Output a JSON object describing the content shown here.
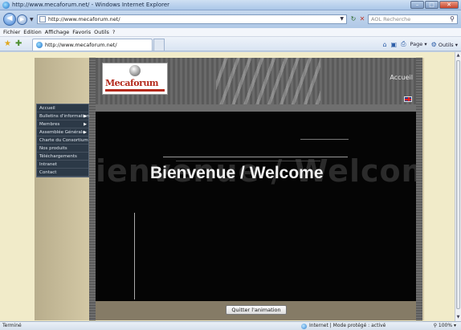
{
  "window": {
    "title": "http://www.mecaforum.net/ - Windows Internet Explorer"
  },
  "addressbar": {
    "url": "http://www.mecaforum.net/",
    "search_placeholder": "AOL Recherche"
  },
  "menubar": {
    "items": [
      "Fichier",
      "Edition",
      "Affichage",
      "Favoris",
      "Outils",
      "?"
    ]
  },
  "tabbar": {
    "tab_label": "http://www.mecaforum.net/",
    "page_label": "Page",
    "tools_label": "Outils"
  },
  "site": {
    "logo_text": "Mecaforum",
    "header_link": "Accueil",
    "menu_items": [
      {
        "label": "Accueil",
        "has_submenu": false
      },
      {
        "label": "Bulletins d'information",
        "has_submenu": true
      },
      {
        "label": "Membres",
        "has_submenu": true
      },
      {
        "label": "Assemblée Générale",
        "has_submenu": true
      },
      {
        "label": "Charte du Consortium",
        "has_submenu": false
      },
      {
        "label": "Nos produits",
        "has_submenu": false
      },
      {
        "label": "Téléchargements",
        "has_submenu": false
      },
      {
        "label": "Intranet",
        "has_submenu": false
      },
      {
        "label": "Contact",
        "has_submenu": false
      }
    ],
    "welcome_text": "Bienvenue / Welcome",
    "ghost_text": "ienvenue / Welcome",
    "quit_button": "Quitter l'animation"
  },
  "statusbar": {
    "status": "Terminé",
    "zone": "Internet | Mode protégé : activé",
    "zoom": "100%"
  },
  "colors": {
    "logo_red": "#b42a1c",
    "stage_bg": "#050505",
    "menu_bg": "#2c3947",
    "page_bg": "#f1ebc9"
  }
}
